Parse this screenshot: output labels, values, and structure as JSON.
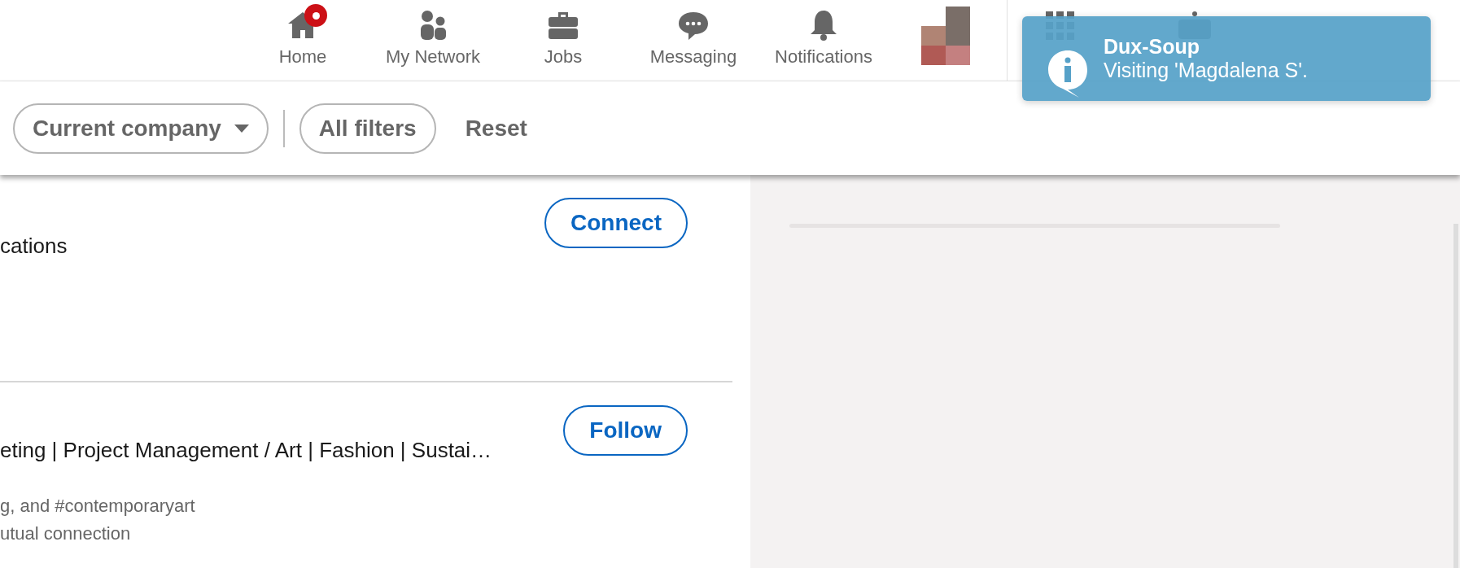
{
  "nav": {
    "items": [
      {
        "label": "Home",
        "badge": true
      },
      {
        "label": "My Network",
        "badge": false
      },
      {
        "label": "Jobs",
        "badge": false
      },
      {
        "label": "Messaging",
        "badge": false
      },
      {
        "label": "Notifications",
        "badge": false
      }
    ]
  },
  "filters": {
    "items": [
      {
        "label": "Current company",
        "kind": "dropdown"
      },
      {
        "label": "All filters",
        "kind": "pill"
      },
      {
        "label": "Reset",
        "kind": "text"
      }
    ]
  },
  "results": [
    {
      "action": "Connect",
      "lines": [
        {
          "text": "cations",
          "kind": "headline"
        }
      ]
    },
    {
      "action": "Follow",
      "lines": [
        {
          "text": "eting | Project Management / Art | Fashion | Sustai…",
          "kind": "headline"
        },
        {
          "text": "g, and #contemporaryart",
          "kind": "meta"
        },
        {
          "text": "utual connection",
          "kind": "meta"
        }
      ]
    }
  ],
  "toast": {
    "title": "Dux-Soup",
    "message": "Visiting 'Magdalena S'."
  }
}
